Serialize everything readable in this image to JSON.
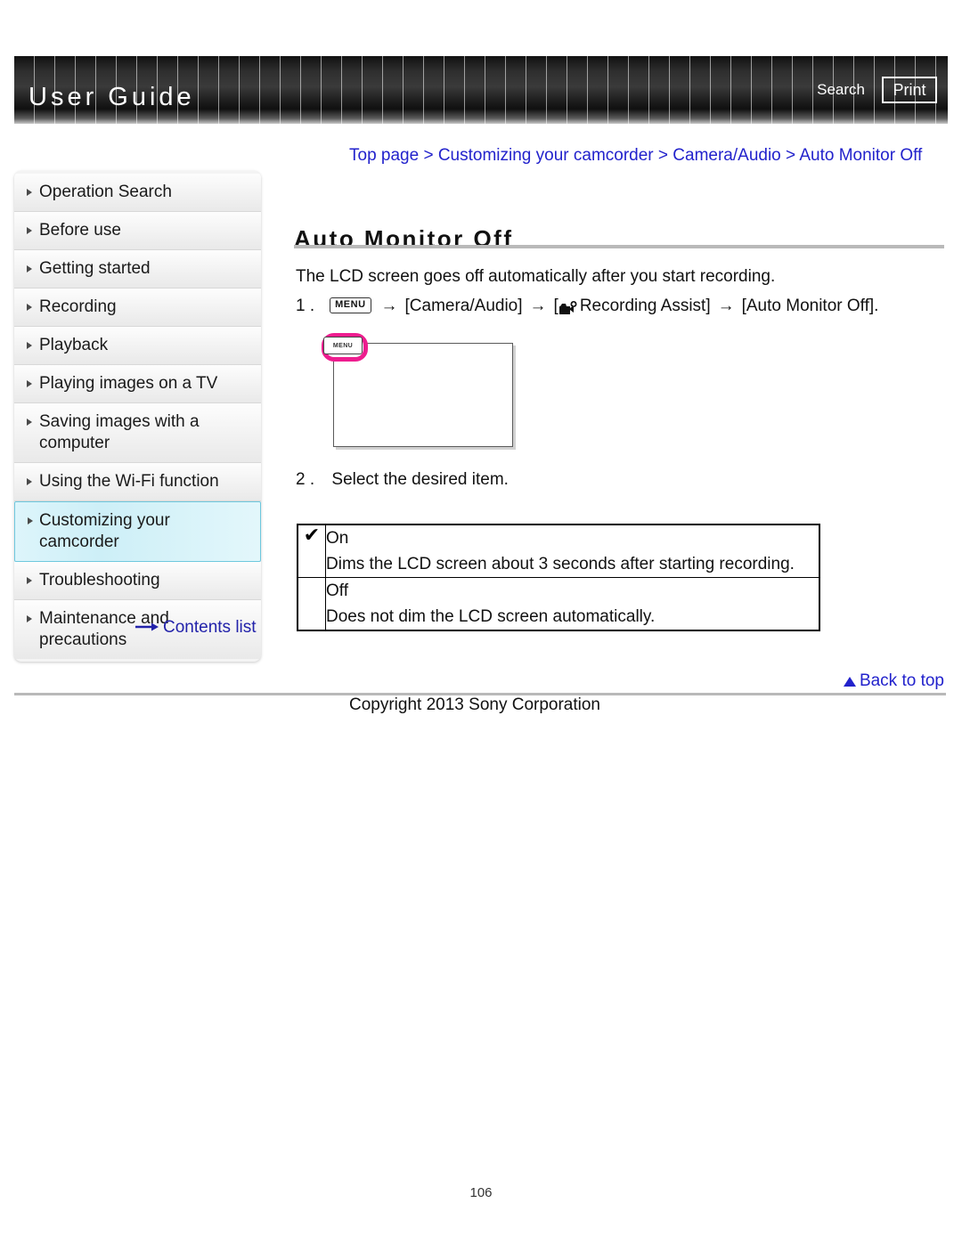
{
  "header": {
    "title": "User Guide",
    "search_label": "Search",
    "print_label": "Print"
  },
  "sidebar": {
    "items": [
      {
        "label": "Operation Search",
        "active": false
      },
      {
        "label": "Before use",
        "active": false
      },
      {
        "label": "Getting started",
        "active": false
      },
      {
        "label": "Recording",
        "active": false
      },
      {
        "label": "Playback",
        "active": false
      },
      {
        "label": "Playing images on a TV",
        "active": false
      },
      {
        "label": "Saving images with a computer",
        "active": false
      },
      {
        "label": "Using the Wi-Fi function",
        "active": false
      },
      {
        "label": "Customizing your camcorder",
        "active": true
      },
      {
        "label": "Troubleshooting",
        "active": false
      },
      {
        "label": "Maintenance and precautions",
        "active": false
      }
    ],
    "contents_list_label": "Contents list"
  },
  "main": {
    "breadcrumb": "Top page > Customizing your camcorder > Camera/Audio > Auto Monitor Off",
    "title": "Auto Monitor Off",
    "intro": "The LCD screen goes off automatically after you start recording.",
    "step1": {
      "number": "1 .",
      "menu_chip": "MENU",
      "arrow": "→",
      "segment_camera_audio": "[Camera/Audio]",
      "segment_recording_assist": "Recording Assist]",
      "bracket_open": "[",
      "segment_auto_monitor_off": "[Auto Monitor Off]."
    },
    "illustration": {
      "menu_chip": "MENU"
    },
    "step2": {
      "number": "2 .",
      "text": "Select the desired item."
    },
    "options_table": {
      "rows": [
        {
          "check": "✔",
          "name": "On",
          "description": "Dims the LCD screen about 3 seconds after starting recording."
        },
        {
          "check": "",
          "name": "Off",
          "description": "Does not dim the LCD screen automatically."
        }
      ]
    }
  },
  "footer": {
    "back_to_top": "Back to top",
    "copyright": "Copyright 2013 Sony Corporation",
    "page_number": "106"
  },
  "colors": {
    "link_blue": "#2222cc",
    "highlight_cyan": "#cdeff7",
    "highlight_border": "#6ec8de",
    "magenta_callout": "#ee1d8f",
    "rule_gray": "#b9b9b9"
  }
}
